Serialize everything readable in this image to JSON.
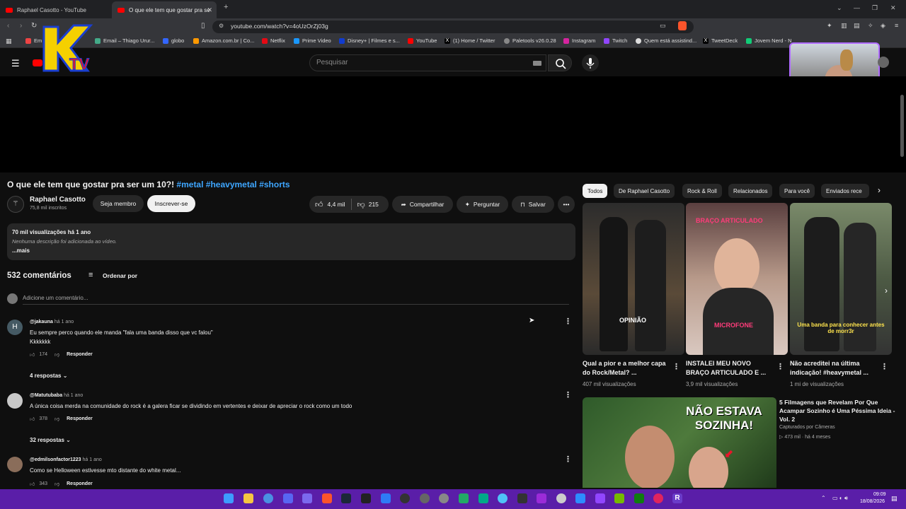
{
  "browser": {
    "tabs": [
      {
        "title": "Raphael Casotto - YouTube"
      },
      {
        "title": "O que ele tem que gostar pra se"
      }
    ],
    "url": "youtube.com/watch?v=4oUzOrZj03g",
    "bookmarks": [
      "Em",
      "Email – Thiago Urur...",
      "globo",
      "Amazon.com.br | Co...",
      "Netflix",
      "Prime Video",
      "Disney+ | Filmes e s...",
      "YouTube",
      "(1) Home / Twitter",
      "Paletools v26.0.28",
      "Instagram",
      "Twitch",
      "Quem está assistind...",
      "TweetDeck",
      "Jovem Nerd - N"
    ]
  },
  "overlay": {
    "logo_text": "KTV"
  },
  "header": {
    "search_placeholder": "Pesquisar"
  },
  "video": {
    "title": "O que ele tem que gostar pra ser um 10?!",
    "hashtags": [
      "#metal",
      "#heavymetal",
      "#shorts"
    ],
    "channel": "Raphael Casotto",
    "subscribers": "75,8 mil inscritos",
    "join_label": "Seja membro",
    "subscribe_label": "Inscrever-se",
    "likes": "4,4 mil",
    "dislikes": "215",
    "share_label": "Compartilhar",
    "ask_label": "Perguntar",
    "save_label": "Salvar",
    "views_age": "70 mil visualizações  há 1 ano",
    "description": "Nenhuma descrição foi adicionada ao vídeo.",
    "more_label": "...mais"
  },
  "comments": {
    "count_label": "532 comentários",
    "sort_label": "Ordenar por",
    "add_placeholder": "Adicione um comentário...",
    "reply_label": "Responder",
    "items": [
      {
        "user": "@jakauna",
        "age": "há 1 ano",
        "text": "Eu sempre perco quando ele manda \"fala uma banda disso que vc falou\"",
        "text2": "Kkkkkkk",
        "likes": "174",
        "replies": "4 respostas"
      },
      {
        "user": "@Matutubaba",
        "age": "há 1 ano",
        "text": "A única coisa merda na comunidade do rock é a galera ficar se dividindo em vertentes e deixar de apreciar o rock como um todo",
        "likes": "378",
        "replies": "32 respostas"
      },
      {
        "user": "@edmilsonfactor1223",
        "age": "há 1 ano",
        "text": "Como se Helloween estivesse mto distante do white metal...",
        "likes": "343"
      }
    ]
  },
  "sidebar": {
    "chips": [
      "Todos",
      "De Raphael Casotto",
      "Rock & Roll",
      "Relacionados",
      "Para você",
      "Enviados rece"
    ],
    "shorts": [
      {
        "title": "Qual a pior e a melhor capa do Rock/Metal? ...",
        "views": "407 mil visualizações",
        "overlay": "OPINIÃO",
        "color": "#3a3a3a"
      },
      {
        "title": "INSTALEI MEU NOVO BRAÇO ARTICULADO E ...",
        "views": "3,9 mil visualizações",
        "overlay_top": "BRAÇO ARTICULADO",
        "overlay_bottom": "MICROFONE",
        "color": "#6b4a4a"
      },
      {
        "title": "Não acreditei na última indicação! #heavymetal ...",
        "views": "1 mi de visualizações",
        "overlay": "Uma banda para conhecer antes de morr3r",
        "color": "#4d5a44"
      }
    ],
    "video": {
      "title": "5 Filmagens que Revelam Por Que Acampar Sozinho é Uma Péssima Ideia - Vol. 2",
      "channel": "Capturados por Câmeras",
      "views": "473 mil",
      "age": "há 4 meses",
      "thumb_text": "NÃO ESTAVA SOZINHA!"
    }
  },
  "taskbar": {
    "time": "09:09",
    "date": "18/08/2026"
  }
}
